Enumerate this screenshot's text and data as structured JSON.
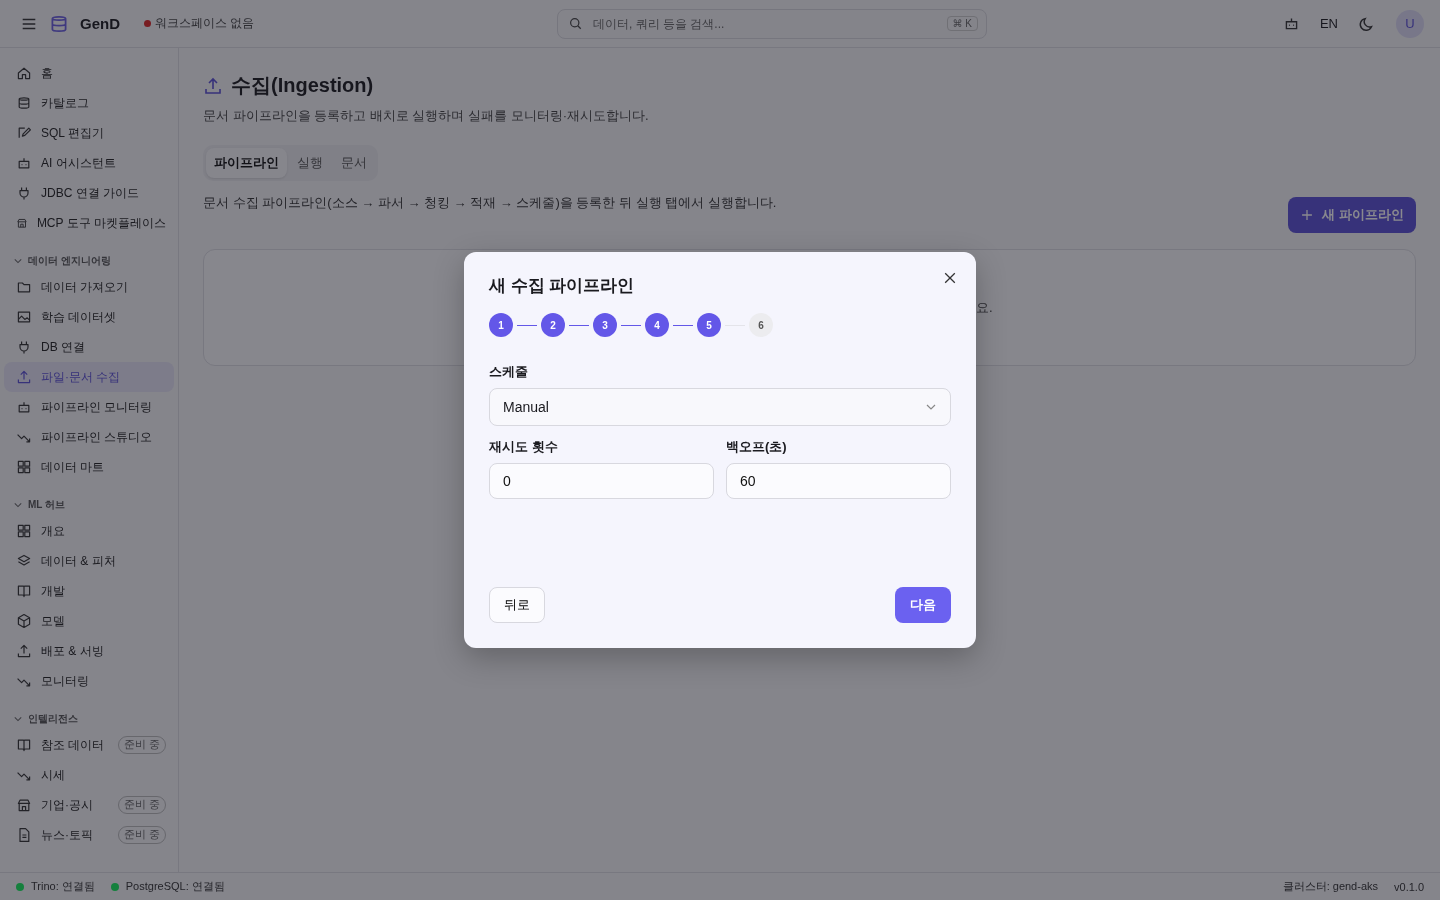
{
  "topbar": {
    "brand": "GenD",
    "workspace": "워크스페이스 없음",
    "search_placeholder": "데이터, 쿼리 등을 검색...",
    "shortcut": "⌘ K",
    "language": "EN",
    "avatar": "U"
  },
  "sidebar": {
    "sections": [
      {
        "items": [
          {
            "label": "홈",
            "selected": false
          },
          {
            "label": "카탈로그",
            "selected": false
          },
          {
            "label": "SQL 편집기",
            "selected": false
          },
          {
            "label": "AI 어시스턴트",
            "selected": false
          },
          {
            "label": "JDBC 연결 가이드",
            "selected": false
          },
          {
            "label": "MCP 도구 마켓플레이스",
            "selected": false
          }
        ]
      },
      {
        "title": "데이터 엔지니어링",
        "expanded": true,
        "items": [
          {
            "label": "데이터 가져오기",
            "selected": false
          },
          {
            "label": "학습 데이터셋",
            "selected": false
          },
          {
            "label": "DB 연결",
            "selected": false
          },
          {
            "label": "파일·문서 수집",
            "selected": true
          },
          {
            "label": "파이프라인 모니터링",
            "selected": false
          },
          {
            "label": "파이프라인 스튜디오",
            "selected": false
          },
          {
            "label": "데이터 마트",
            "selected": false
          }
        ]
      },
      {
        "title": "ML 허브",
        "expanded": true,
        "items": [
          {
            "label": "개요",
            "selected": false
          },
          {
            "label": "데이터 & 피처",
            "selected": false
          },
          {
            "label": "개발",
            "selected": false
          },
          {
            "label": "모델",
            "selected": false
          },
          {
            "label": "배포 & 서빙",
            "selected": false
          },
          {
            "label": "모니터링",
            "selected": false
          }
        ]
      },
      {
        "title": "인텔리전스",
        "expanded": true,
        "items": [
          {
            "label": "참조 데이터",
            "selected": false,
            "badge": "준비 중"
          },
          {
            "label": "시세",
            "selected": false
          },
          {
            "label": "기업·공시",
            "selected": false,
            "badge": "준비 중"
          },
          {
            "label": "뉴스·토픽",
            "selected": false,
            "badge": "준비 중"
          }
        ]
      }
    ]
  },
  "page": {
    "title": "수집(Ingestion)",
    "subtitle": "문서 파이프라인을 등록하고 배치로 실행하며 실패를 모니터링·재시도합니다.",
    "tabs": [
      {
        "label": "파이프라인",
        "selected": true
      },
      {
        "label": "실행",
        "selected": false
      },
      {
        "label": "문서",
        "selected": false
      }
    ],
    "description": "문서 수집 파이프라인(소스 → 파서 → 청킹 → 적재 → 스케줄)을 등록한 뒤 실행 탭에서 실행합니다.",
    "new_button": "새 파이프라인",
    "card_text_fragment": "요."
  },
  "dialog": {
    "title": "새 수집 파이프라인",
    "steps": [
      {
        "label": "1",
        "completed": true
      },
      {
        "label": "2",
        "completed": true
      },
      {
        "label": "3",
        "completed": true
      },
      {
        "label": "4",
        "completed": true
      },
      {
        "label": "5",
        "completed": true
      },
      {
        "label": "6",
        "completed": false
      }
    ],
    "schedule_label": "스케줄",
    "schedule_value": "Manual",
    "fields": [
      {
        "label": "재시도 횟수",
        "value": "0"
      },
      {
        "label": "백오프(초)",
        "value": "60"
      }
    ],
    "back_button": "뒤로",
    "next_button": "다음"
  },
  "status_bar": {
    "connections": [
      {
        "label": "Trino: 연결됨",
        "color": "#15803d"
      },
      {
        "label": "PostgreSQL: 연결됨",
        "color": "#15803d"
      }
    ],
    "cluster": "클러스터: gend-aks",
    "version": "v0.1.0"
  }
}
